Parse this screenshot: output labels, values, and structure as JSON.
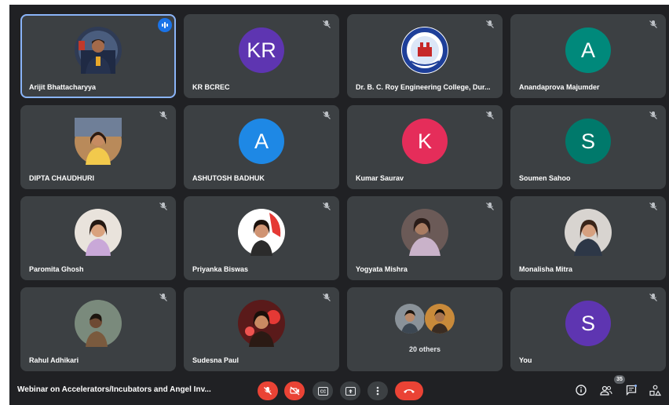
{
  "meeting": {
    "title": "Webinar on Accelerators/Incubators and Angel Inv..."
  },
  "participants": [
    {
      "name": "Arijit Bhattacharyya",
      "avatar_type": "photo",
      "speaking": true,
      "muted": false
    },
    {
      "name": "KR BCREC",
      "avatar_type": "initials",
      "initials": "KR",
      "color": "#5e35b1",
      "muted": true
    },
    {
      "name": "Dr. B. C. Roy Engineering College, Dur...",
      "avatar_type": "logo",
      "muted": true
    },
    {
      "name": "Anandaprova Majumder",
      "avatar_type": "initials",
      "initials": "A",
      "color": "#00897b",
      "muted": true
    },
    {
      "name": "DIPTA CHAUDHURI",
      "avatar_type": "photo",
      "muted": true
    },
    {
      "name": "ASHUTOSH BADHUK",
      "avatar_type": "initials",
      "initials": "A",
      "color": "#1e88e5",
      "muted": true
    },
    {
      "name": "Kumar Saurav",
      "avatar_type": "initials",
      "initials": "K",
      "color": "#e52d5a",
      "muted": true
    },
    {
      "name": "Soumen Sahoo",
      "avatar_type": "initials",
      "initials": "S",
      "color": "#00796b",
      "muted": true
    },
    {
      "name": "Paromita Ghosh",
      "avatar_type": "photo",
      "muted": true
    },
    {
      "name": "Priyanka Biswas",
      "avatar_type": "photo",
      "muted": true
    },
    {
      "name": "Yogyata Mishra",
      "avatar_type": "photo",
      "muted": true
    },
    {
      "name": "Monalisha Mitra",
      "avatar_type": "photo",
      "muted": true
    },
    {
      "name": "Rahul Adhikari",
      "avatar_type": "photo",
      "muted": true
    },
    {
      "name": "Sudesna Paul",
      "avatar_type": "photo",
      "muted": true
    },
    {
      "name": "",
      "avatar_type": "others",
      "others_label": "20 others"
    },
    {
      "name": "You",
      "avatar_type": "initials",
      "initials": "S",
      "color": "#5e35b1",
      "muted": true
    }
  ],
  "controls": {
    "mic": {
      "state": "off",
      "color": "#ea4335"
    },
    "camera": {
      "state": "off",
      "color": "#ea4335"
    },
    "captions_icon": "closed-captions-icon",
    "present_icon": "present-now-icon",
    "more_icon": "more-options-icon",
    "hangup_icon": "hang-up-icon"
  },
  "side_panel": {
    "participants_count": "35",
    "info_icon": "info-icon",
    "people_icon": "people-icon",
    "chat_icon": "chat-icon",
    "activities_icon": "activities-icon"
  }
}
